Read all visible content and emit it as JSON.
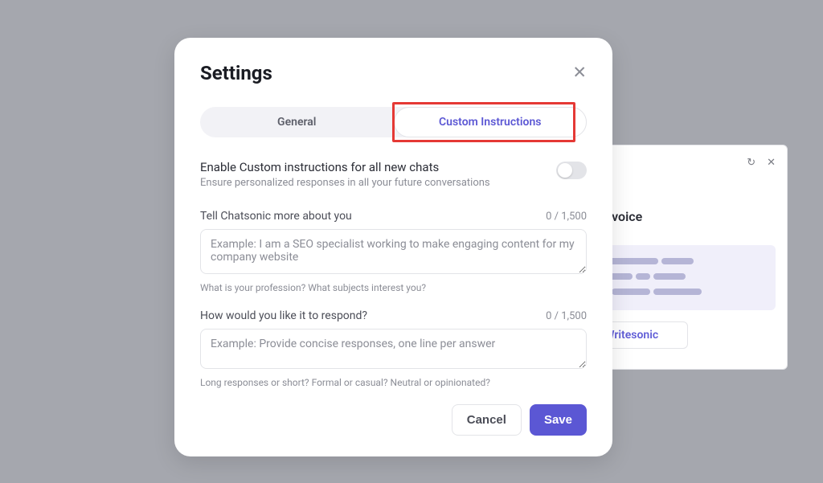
{
  "modal": {
    "title": "Settings",
    "tabs": {
      "general": "General",
      "custom": "Custom Instructions"
    },
    "toggle": {
      "title": "Enable Custom instructions for all new chats",
      "subtitle": "Ensure personalized responses in all your future conversations"
    },
    "field_about": {
      "label": "Tell Chatsonic more about you",
      "counter": "0 / 1,500",
      "placeholder": "Example: I am a SEO specialist working to make engaging content for my company website",
      "hint": "What is your profession? What subjects interest you?"
    },
    "field_respond": {
      "label": "How would you like it to respond?",
      "counter": "0 / 1,500",
      "placeholder": "Example: Provide concise responses, one line per answer",
      "hint": "Long responses or short? Formal or casual? Neutral or opinionated?"
    },
    "buttons": {
      "cancel": "Cancel",
      "save": "Save"
    }
  },
  "bg_panel": {
    "title": "Brand voice",
    "brand_button": "Writesonic"
  }
}
